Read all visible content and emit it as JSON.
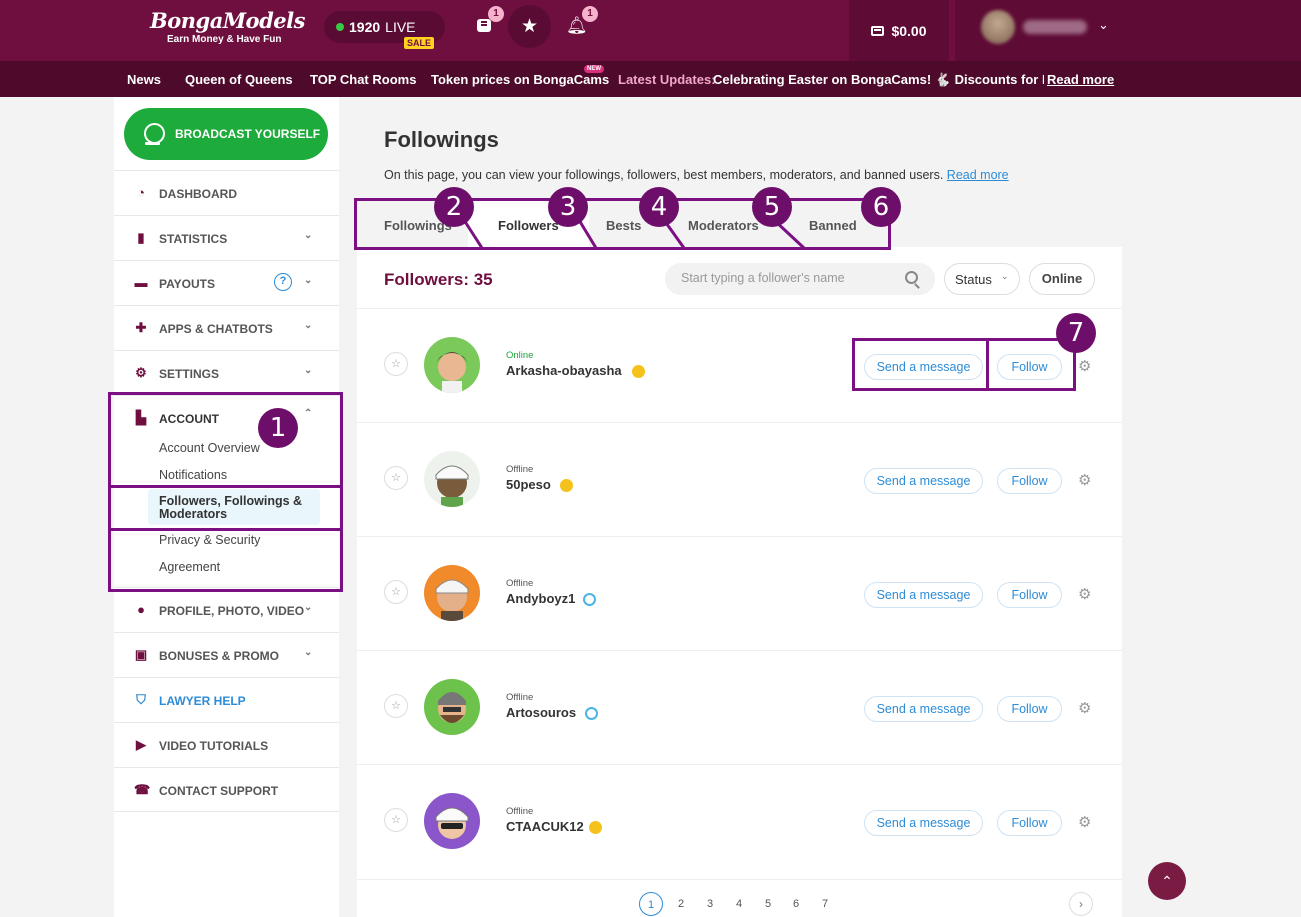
{
  "header": {
    "logo_text": "BongaModels",
    "logo_tagline": "Earn Money & Have Fun",
    "live_count": "1920",
    "live_label": "LIVE",
    "sale_badge": "SALE",
    "messages_badge": "1",
    "notifications_badge": "1",
    "balance": "$0.00"
  },
  "subnav": {
    "items": [
      "News",
      "Queen of Queens",
      "TOP Chat Rooms",
      "Token prices on BongaCams"
    ],
    "new_badge": "NEW",
    "latest_label": "Latest Updates:",
    "ticker": "Celebrating Easter on BongaCams! 🐇 Discounts for Memb",
    "read_more": "Read more"
  },
  "sidebar": {
    "broadcast": "BROADCAST YOURSELF",
    "items": [
      {
        "label": "DASHBOARD",
        "icon": "gauge-icon"
      },
      {
        "label": "STATISTICS",
        "icon": "bar-chart-icon"
      },
      {
        "label": "PAYOUTS",
        "icon": "card-icon"
      },
      {
        "label": "APPS & CHATBOTS",
        "icon": "puzzle-icon"
      },
      {
        "label": "SETTINGS",
        "icon": "gear-icon"
      },
      {
        "label": "ACCOUNT",
        "icon": "account-icon"
      },
      {
        "label": "PROFILE, PHOTO, VIDEO",
        "icon": "person-icon"
      },
      {
        "label": "BONUSES & PROMO",
        "icon": "gift-icon"
      },
      {
        "label": "LAWYER HELP",
        "icon": "shield-icon"
      },
      {
        "label": "VIDEO TUTORIALS",
        "icon": "video-icon"
      },
      {
        "label": "CONTACT SUPPORT",
        "icon": "support-icon"
      }
    ],
    "account_sub": [
      "Account Overview",
      "Notifications",
      "Followers, Followings & Moderators",
      "Privacy & Security",
      "Agreement"
    ]
  },
  "main": {
    "title": "Followings",
    "description": "On this page, you can view your followings, followers, best members, moderators, and banned users.",
    "read_more": "Read more",
    "tabs": [
      "Followings",
      "Followers",
      "Bests",
      "Moderators",
      "Banned"
    ],
    "active_tab": "Followers",
    "followers_count_label": "Followers: 35",
    "search_placeholder": "Start typing a follower's name",
    "status_label": "Status",
    "online_label": "Online",
    "send_message": "Send a message",
    "follow": "Follow",
    "rows": [
      {
        "status": "Online",
        "name": "Arkasha-obayasha",
        "level": "gold"
      },
      {
        "status": "Offline",
        "name": "50peso",
        "level": "gold"
      },
      {
        "status": "Offline",
        "name": "Andyboyz1",
        "level": "blue"
      },
      {
        "status": "Offline",
        "name": "Artosouros",
        "level": "blue"
      },
      {
        "status": "Offline",
        "name": "CTAACUK12",
        "level": "gold"
      }
    ],
    "pages": [
      "1",
      "2",
      "3",
      "4",
      "5",
      "6",
      "7"
    ],
    "current_page": "1"
  },
  "annotations": [
    "1",
    "2",
    "3",
    "4",
    "5",
    "6",
    "7"
  ],
  "colors": {
    "brand": "#6e0f3f",
    "accent": "#2d8cd6",
    "annotation": "#7b1082",
    "broadcast": "#1dab3b"
  }
}
